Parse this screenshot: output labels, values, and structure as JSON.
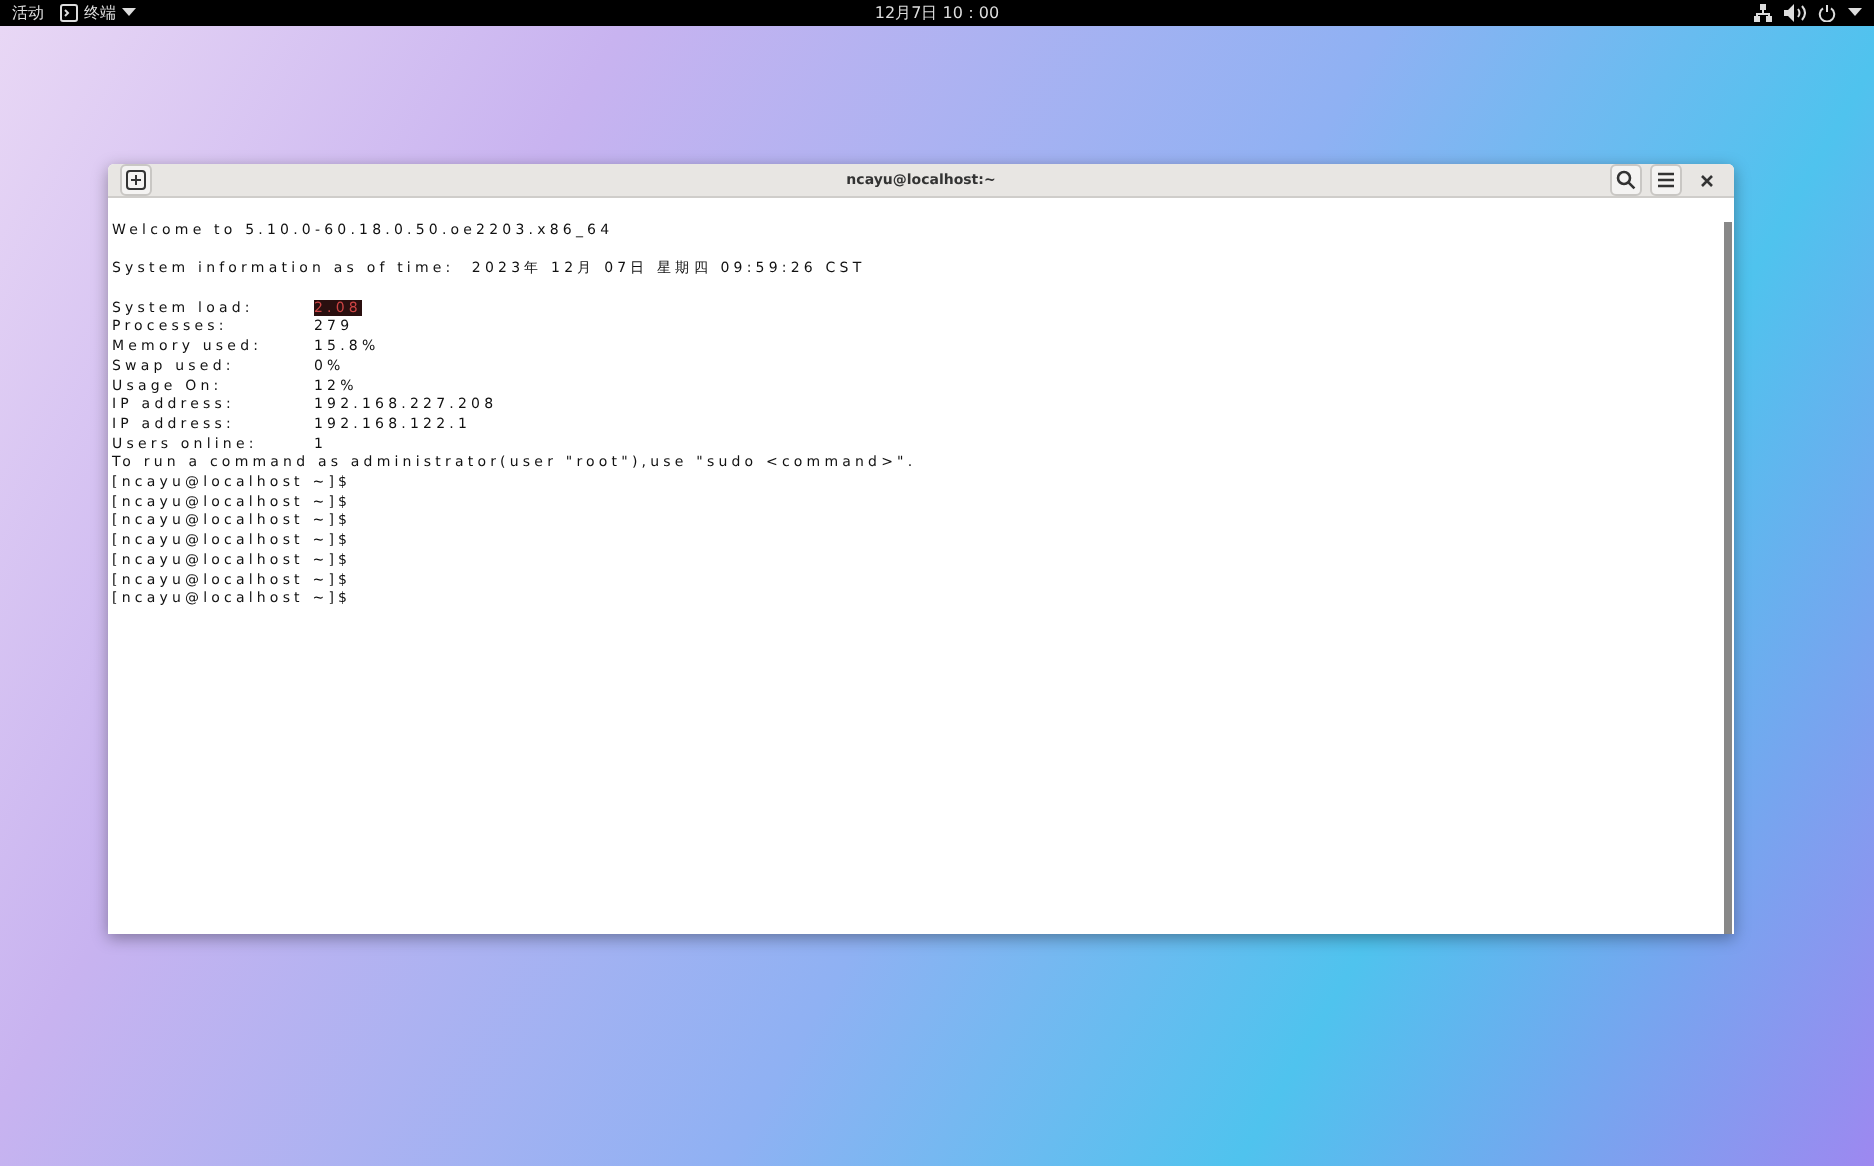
{
  "top_bar": {
    "activities": "活动",
    "app_menu": "终端",
    "clock": "12月7日 10：00"
  },
  "window": {
    "title": "ncayu@localhost:~"
  },
  "terminal": {
    "welcome": "Welcome to 5.10.0-60.18.0.50.oe2203.x86_64",
    "sysinfo": "System information as of time:  2023年 12月 07日 星期四 09:59:26 CST",
    "stats": [
      {
        "label": "System load:",
        "value": "2.08",
        "highlighted": true
      },
      {
        "label": "Processes:",
        "value": "279",
        "highlighted": false
      },
      {
        "label": "Memory used:",
        "value": "15.8%",
        "highlighted": false
      },
      {
        "label": "Swap used:",
        "value": "0%",
        "highlighted": false
      },
      {
        "label": "Usage On:",
        "value": "12%",
        "highlighted": false
      },
      {
        "label": "IP address:",
        "value": "192.168.227.208",
        "highlighted": false
      },
      {
        "label": "IP address:",
        "value": "192.168.122.1",
        "highlighted": false
      },
      {
        "label": "Users online:",
        "value": "1",
        "highlighted": false
      }
    ],
    "notice": "To run a command as administrator(user \"root\"),use \"sudo <command>\".",
    "prompts": [
      "[ncayu@localhost ~]$",
      "[ncayu@localhost ~]$",
      "[ncayu@localhost ~]$",
      "[ncayu@localhost ~]$",
      "[ncayu@localhost ~]$",
      "[ncayu@localhost ~]$",
      "[ncayu@localhost ~]$"
    ]
  }
}
